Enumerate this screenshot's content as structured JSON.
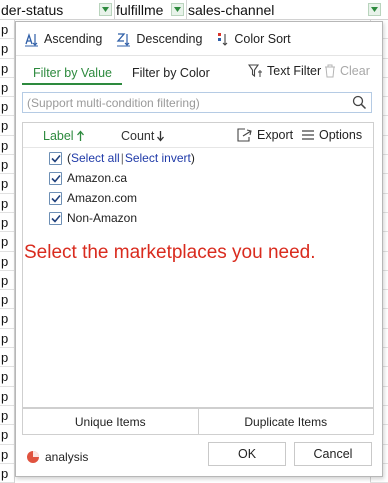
{
  "sheet": {
    "headers": [
      {
        "label": "der-status"
      },
      {
        "label": "fulfillme"
      },
      {
        "label": "sales-channel"
      }
    ],
    "row_prefix": [
      "p",
      "p",
      "p",
      "p",
      "p",
      "p",
      "p",
      "p",
      "p",
      "p",
      "p",
      "p",
      "p",
      "p",
      "p",
      "p",
      "p",
      "p",
      "p",
      "p",
      "p",
      "p",
      "p",
      "p"
    ]
  },
  "sort_bar": {
    "ascending": "Ascending",
    "descending": "Descending",
    "color_sort": "Color Sort"
  },
  "tabs": {
    "by_value": "Filter by Value",
    "by_color": "Filter by Color",
    "text_filter": "Text Filter",
    "clear": "Clear"
  },
  "search": {
    "placeholder": "(Support multi-condition filtering)"
  },
  "list_header": {
    "label": "Label",
    "count": "Count",
    "export": "Export",
    "options": "Options"
  },
  "items": {
    "select_all": "Select all",
    "select_invert": "Select invert",
    "values": [
      "Amazon.ca",
      "Amazon.com",
      "Non-Amazon"
    ]
  },
  "instruction": "Select the marketplaces you need.",
  "buttons": {
    "unique": "Unique Items",
    "duplicate": "Duplicate Items",
    "analysis": "analysis",
    "ok": "OK",
    "cancel": "Cancel"
  },
  "colors": {
    "accent_green": "#2d8a3e",
    "instruction_red": "#d92b1e",
    "link_blue": "#1f3aa8"
  }
}
